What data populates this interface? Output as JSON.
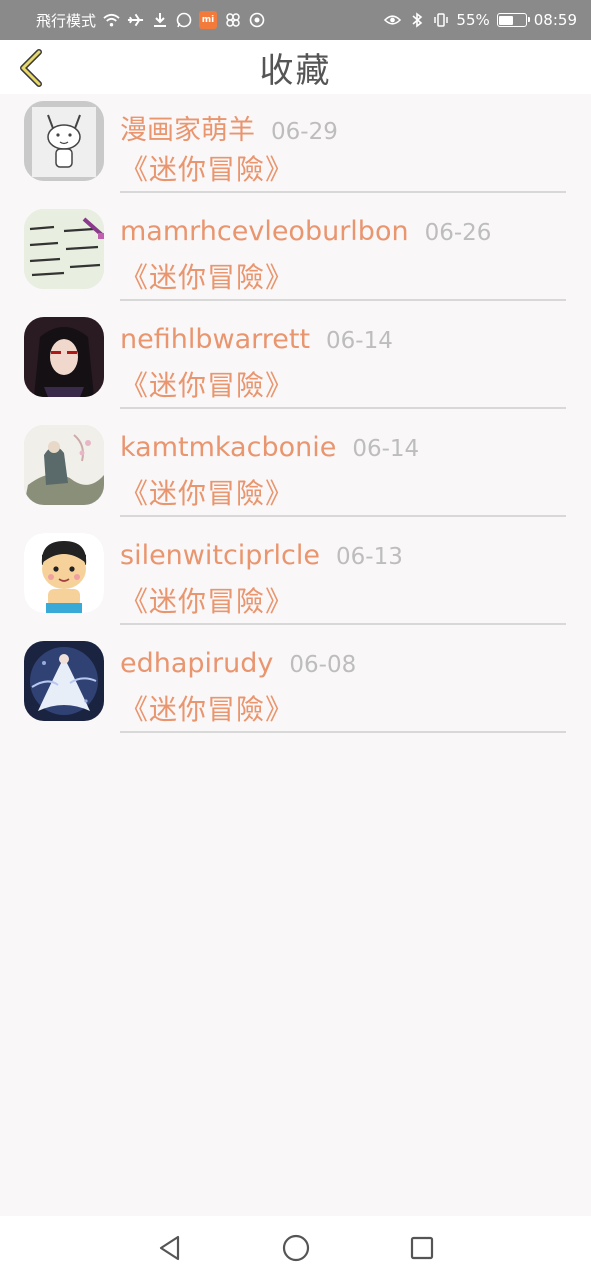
{
  "status_bar": {
    "mode_text": "飛行模式",
    "battery_percent": "55%",
    "battery_level": 0.55,
    "time": "08:59",
    "icons": [
      "wifi-icon",
      "airplane-icon",
      "download-icon",
      "whatsapp-icon",
      "mi-icon",
      "pinwheel-icon",
      "chrome-icon",
      "eye-icon",
      "bluetooth-icon",
      "vibrate-icon",
      "battery-icon"
    ],
    "mi_label": "mi"
  },
  "header": {
    "title": "收藏",
    "back_icon": "chevron-left-icon",
    "accent_color": "#e9956e"
  },
  "favorites": [
    {
      "name": "漫画家萌羊",
      "date": "06-29",
      "work": "《迷你冒險》",
      "avatar": "sketch-character"
    },
    {
      "name": "mamrhcevleoburlbon",
      "date": "06-26",
      "work": "《迷你冒險》",
      "avatar": "handwriting-note"
    },
    {
      "name": "nefihlbwarrett",
      "date": "06-14",
      "work": "《迷你冒險》",
      "avatar": "anime-ninja"
    },
    {
      "name": "kamtmkacbonie",
      "date": "06-14",
      "work": "《迷你冒險》",
      "avatar": "ink-painting"
    },
    {
      "name": "silenwitciprlcle",
      "date": "06-13",
      "work": "《迷你冒險》",
      "avatar": "cartoon-boy"
    },
    {
      "name": "edhapirudy",
      "date": "06-08",
      "work": "《迷你冒險》",
      "avatar": "dancer"
    }
  ],
  "nav_bar": {
    "buttons": [
      "back-triangle-icon",
      "home-circle-icon",
      "recents-square-icon"
    ]
  }
}
